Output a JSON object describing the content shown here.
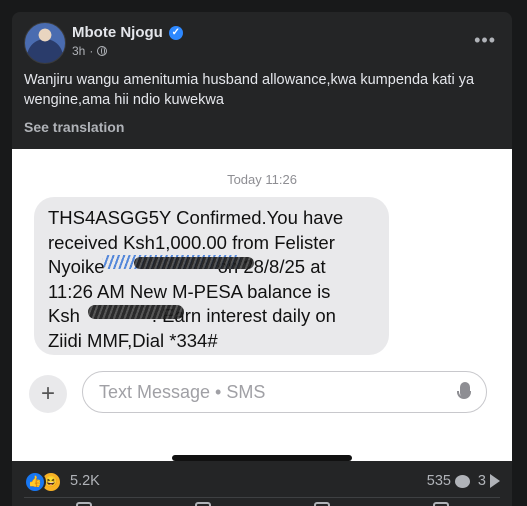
{
  "post": {
    "author": "Mbote Njogu",
    "time": "3h",
    "caption": "Wanjiru wangu amenitumia husband allowance,kwa kumpenda kati ya wengine,ama hii ndio kuwekwa",
    "see_translation": "See translation"
  },
  "sms": {
    "timestamp": "Today 11:26",
    "message_lines": [
      "THS4ASGG5Y Confirmed.You have",
      "received Ksh1,000.00 from Felister",
      "Nyoike                      on 28/8/25 at",
      "11:26 AM  New M-PESA balance is",
      "Ksh              . Earn interest daily on",
      "Ziidi MMF,Dial *334#"
    ],
    "compose_placeholder": "Text Message • SMS"
  },
  "footer": {
    "reactions_count": "5.2K",
    "comments_count": "535",
    "shares_count": "3"
  },
  "colors": {
    "background": "#18191a",
    "card": "#242526",
    "accent": "#2d88ff"
  }
}
